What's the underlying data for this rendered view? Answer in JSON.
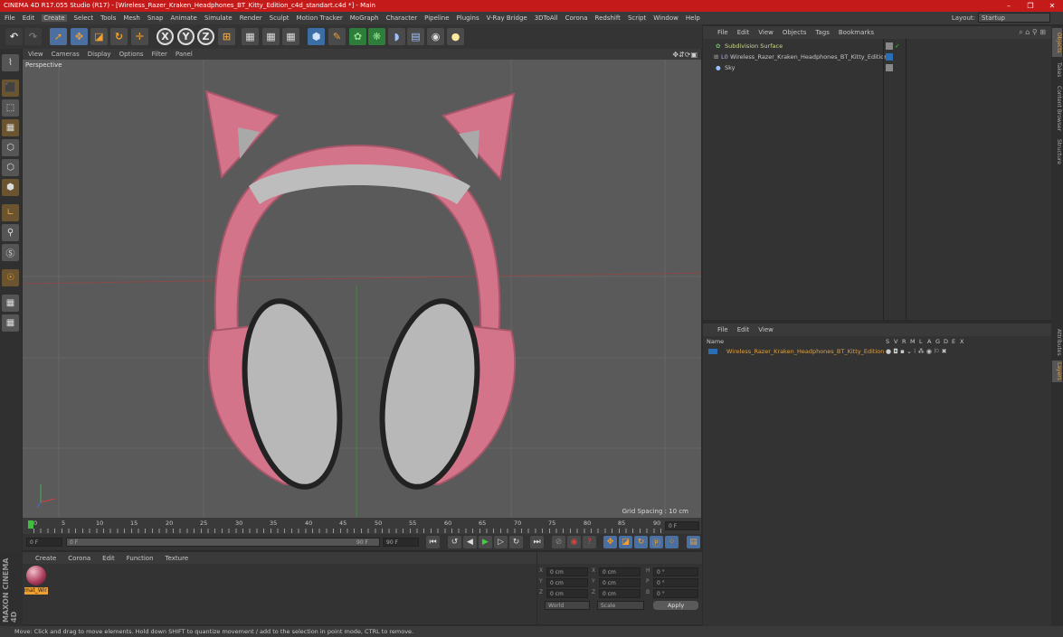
{
  "window": {
    "title": "CINEMA 4D R17.055 Studio (R17) - [Wireless_Razer_Kraken_Headphones_BT_Kitty_Edition_c4d_standart.c4d *] - Main",
    "minimize": "–",
    "maximize": "❐",
    "close": "✕"
  },
  "menu": [
    "File",
    "Edit",
    "Create",
    "Select",
    "Tools",
    "Mesh",
    "Snap",
    "Animate",
    "Simulate",
    "Render",
    "Sculpt",
    "Motion Tracker",
    "MoGraph",
    "Character",
    "Pipeline",
    "Plugins",
    "V-Ray Bridge",
    "3DToAll",
    "Corona",
    "Redshift",
    "Script",
    "Window",
    "Help"
  ],
  "layout": {
    "label": "Layout:",
    "value": "Startup"
  },
  "toolbar": {
    "x_axis": "X",
    "y_axis": "Y",
    "z_axis": "Z"
  },
  "viewport": {
    "menu": [
      "View",
      "Cameras",
      "Display",
      "Options",
      "Filter",
      "Panel"
    ],
    "label": "Perspective",
    "grid_spacing": "Grid Spacing : 10 cm"
  },
  "timeline": {
    "ticks": [
      "0",
      "5",
      "10",
      "15",
      "20",
      "25",
      "30",
      "35",
      "40",
      "45",
      "50",
      "55",
      "60",
      "65",
      "70",
      "75",
      "80",
      "85",
      "90"
    ],
    "current_frame": "0 F",
    "start_field": "0 F",
    "range_start": "0 F",
    "range_end": "90 F",
    "end_field": "90 F"
  },
  "material_manager": {
    "menu": [
      "Create",
      "Corona",
      "Edit",
      "Function",
      "Texture"
    ],
    "material_name": "mat_Wir"
  },
  "coordinates": {
    "rows": [
      {
        "a": "X",
        "av": "0 cm",
        "b": "X",
        "bv": "0 cm",
        "c": "H",
        "cv": "0 °"
      },
      {
        "a": "Y",
        "av": "0 cm",
        "b": "Y",
        "bv": "0 cm",
        "c": "P",
        "cv": "0 °"
      },
      {
        "a": "Z",
        "av": "0 cm",
        "b": "Z",
        "bv": "0 cm",
        "c": "B",
        "cv": "0 °"
      }
    ],
    "mode1": "World",
    "mode2": "Scale",
    "apply": "Apply"
  },
  "object_manager": {
    "menu": [
      "File",
      "Edit",
      "View",
      "Objects",
      "Tags",
      "Bookmarks"
    ],
    "objects": [
      {
        "name": "Subdivision Surface",
        "color": "#c8d890"
      },
      {
        "name": "Wireless_Razer_Kraken_Headphones_BT_Kitty_Edition",
        "color": "#c8c8c8"
      },
      {
        "name": "Sky",
        "color": "#c8c8c8"
      }
    ]
  },
  "layer_manager": {
    "menu": [
      "File",
      "Edit",
      "View"
    ],
    "columns": {
      "name": "Name",
      "flags": [
        "S",
        "V",
        "R",
        "M",
        "L",
        "A",
        "G",
        "D",
        "E",
        "X"
      ]
    },
    "row_name": "Wireless_Razer_Kraken_Headphones_BT_Kitty_Edition",
    "row_color": "#e0a040"
  },
  "side_tabs": [
    "Objects",
    "Takes",
    "Content Browser",
    "Structure"
  ],
  "side_tabs2": [
    "Attributes",
    "Layers"
  ],
  "brand": "MAXON CINEMA 4D",
  "status": "Move: Click and drag to move elements. Hold down SHIFT to quantize movement / add to the selection in point mode, CTRL to remove.",
  "colors": {
    "accent_red": "#c41a1a",
    "selection_blue": "#2a6fb5",
    "headphone_pink": "#d4748a"
  }
}
